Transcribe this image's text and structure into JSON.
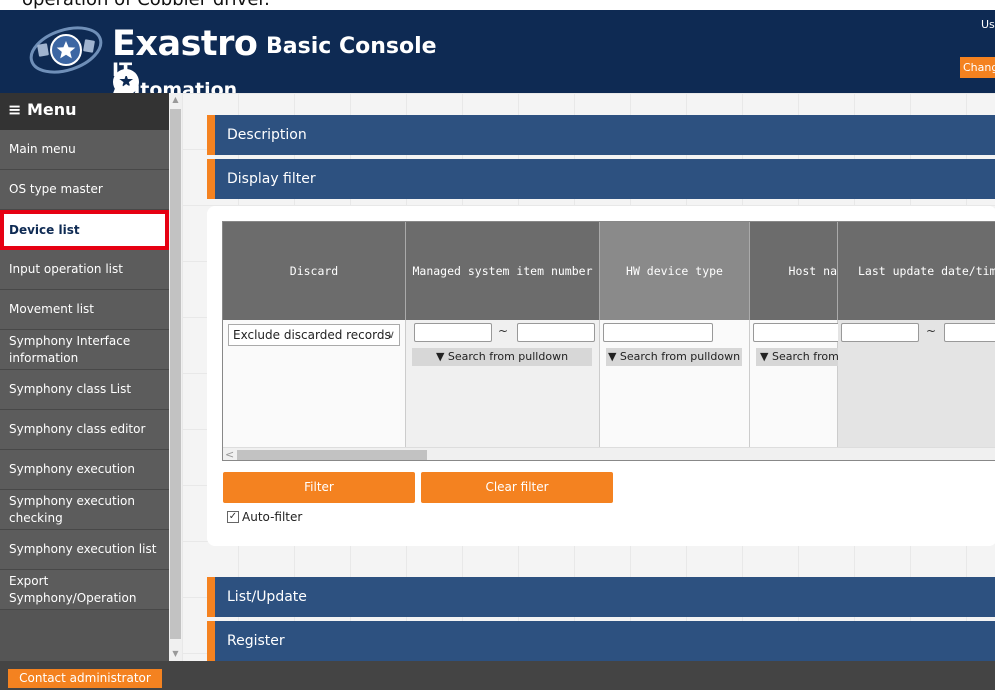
{
  "caption": "operation of Cobbler driver.",
  "header": {
    "logo_title": "Exastro",
    "logo_sub": "IT Automation",
    "console_title": "Basic Console",
    "user_label": "Us",
    "change_button": "Chang",
    "brand_color": "#0e2a53",
    "accent_color": "#f48220"
  },
  "sidebar": {
    "heading": "Menu",
    "items": [
      {
        "label": "Main menu"
      },
      {
        "label": "OS type master"
      },
      {
        "label": "Device list",
        "active": true
      },
      {
        "label": "Input operation list"
      },
      {
        "label": "Movement list"
      },
      {
        "label": "Symphony Interface information"
      },
      {
        "label": "Symphony class List"
      },
      {
        "label": "Symphony class editor"
      },
      {
        "label": "Symphony execution"
      },
      {
        "label": "Symphony execution checking"
      },
      {
        "label": "Symphony execution list"
      },
      {
        "label": "Export Symphony/Operation"
      }
    ]
  },
  "sections": {
    "description": "Description",
    "display_filter": "Display filter",
    "list_update": "List/Update",
    "register": "Register"
  },
  "filter_table": {
    "columns": [
      {
        "header": "Discard"
      },
      {
        "header": "Managed system item number"
      },
      {
        "header": "HW device type"
      },
      {
        "header": "Host na"
      },
      {
        "header": "Last update date/tim"
      }
    ],
    "discard_value": "Exclude discarded records",
    "tilde": "~",
    "pulldown_label": "▼ Search from pulldown",
    "pulldown_label_cut": "▼ Search from"
  },
  "buttons": {
    "filter": "Filter",
    "clear_filter": "Clear filter"
  },
  "auto_filter": {
    "label": "Auto-filter",
    "checked": true
  },
  "footer": {
    "contact": "Contact administrator"
  }
}
